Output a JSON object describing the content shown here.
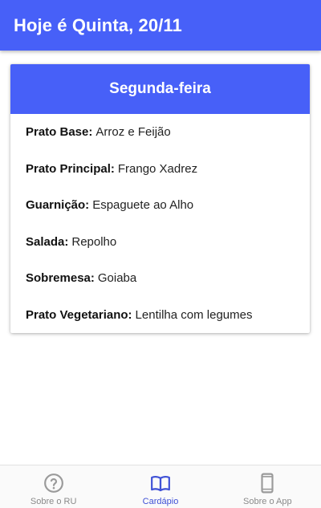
{
  "appbar": {
    "title": "Hoje é Quinta, 20/11"
  },
  "card": {
    "title": "Segunda-feira",
    "items": [
      {
        "label": "Prato Base:",
        "value": "Arroz e Feijão"
      },
      {
        "label": "Prato Principal:",
        "value": "Frango Xadrez"
      },
      {
        "label": "Guarnição:",
        "value": "Espaguete ao Alho"
      },
      {
        "label": "Salada:",
        "value": "Repolho"
      },
      {
        "label": "Sobremesa:",
        "value": "Goiaba"
      },
      {
        "label": "Prato Vegetariano:",
        "value": "Lentilha com legumes"
      }
    ]
  },
  "bottom_nav": {
    "items": [
      {
        "label": "Sobre o RU",
        "icon": "help-circle-icon",
        "active": false
      },
      {
        "label": "Cardápio",
        "icon": "book-icon",
        "active": true
      },
      {
        "label": "Sobre o App",
        "icon": "phone-icon",
        "active": false
      }
    ]
  },
  "colors": {
    "primary": "#4760f8",
    "active_nav": "#3f51d6",
    "inactive_nav": "#8a8a8a"
  }
}
